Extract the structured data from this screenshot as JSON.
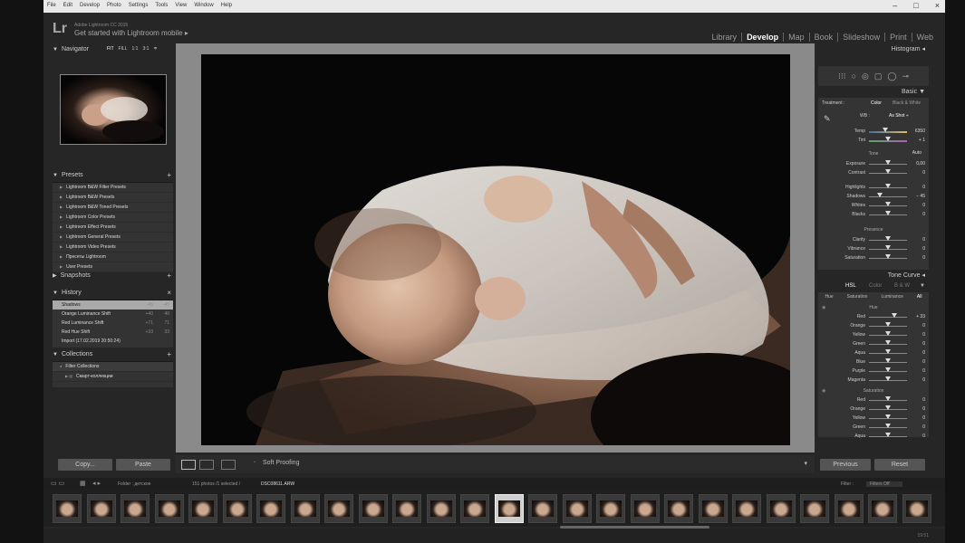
{
  "app": {
    "menu": [
      "File",
      "Edit",
      "Develop",
      "Photo",
      "Settings",
      "Tools",
      "View",
      "Window",
      "Help"
    ],
    "window_controls": [
      "–",
      "□",
      "×"
    ],
    "logo": "Lr",
    "subtitle": "Adobe Lightroom CC 2015",
    "mobile_prompt": "Get started with Lightroom mobile",
    "mobile_arrow": "▸",
    "modules": [
      {
        "label": "Library",
        "active": false
      },
      {
        "label": "Develop",
        "active": true
      },
      {
        "label": "Map",
        "active": false
      },
      {
        "label": "Book",
        "active": false
      },
      {
        "label": "Slideshow",
        "active": false
      },
      {
        "label": "Print",
        "active": false
      },
      {
        "label": "Web",
        "active": false
      }
    ]
  },
  "left": {
    "navigator": {
      "title": "Navigator",
      "zoom": [
        "FIT",
        "FILL",
        "1:1",
        "3:1"
      ],
      "zoom_extra": "≑"
    },
    "presets": {
      "title": "Presets",
      "items": [
        "Lightroom B&W Filter Presets",
        "Lightroom B&W Presets",
        "Lightroom B&W Toned Presets",
        "Lightroom Color Presets",
        "Lightroom Effect Presets",
        "Lightroom General Presets",
        "Lightroom Video Presets",
        "Пресеты Lightroom",
        "User Presets"
      ]
    },
    "snapshots": {
      "title": "Snapshots"
    },
    "history": {
      "title": "History",
      "items": [
        {
          "label": "Shadows",
          "a": "-45",
          "b": "-45",
          "selected": true
        },
        {
          "label": "Orange Luminance Shift",
          "a": "+40",
          "b": "40",
          "selected": false
        },
        {
          "label": "Red Luminance Shift",
          "a": "+71",
          "b": "71",
          "selected": false
        },
        {
          "label": "Red Hue Shift",
          "a": "+33",
          "b": "33",
          "selected": false
        },
        {
          "label": "Import (17.02.2019 20:50:24)",
          "a": "",
          "b": "",
          "selected": false
        }
      ]
    },
    "collections": {
      "title": "Collections",
      "items": [
        "Filter Collections",
        "Смарт-коллекции"
      ]
    },
    "copy_label": "Copy...",
    "paste_label": "Paste"
  },
  "toolbar": {
    "soft_proofing": "Soft Proofing"
  },
  "right": {
    "histogram": "Histogram",
    "tool_icons": [
      "⁝⁝⁝",
      "○",
      "◎",
      "▢",
      "◯",
      "⊸"
    ],
    "basic": {
      "title": "Basic",
      "treatment_label": "Treatment :",
      "color_label": "Color",
      "bw_label": "Black & White",
      "wb_label": "WB :",
      "wb_value": "As Shot ÷",
      "temp": {
        "label": "Temp",
        "value": "6350",
        "pos": 0.42
      },
      "tint": {
        "label": "Tint",
        "value": "+ 1",
        "pos": 0.5
      },
      "tone_label": "Tone",
      "auto_label": "Auto",
      "sliders": [
        {
          "label": "Exposure",
          "value": "0,00",
          "pos": 0.5
        },
        {
          "label": "Contrast",
          "value": "0",
          "pos": 0.5
        },
        {
          "label": "Highlights",
          "value": "0",
          "pos": 0.5
        },
        {
          "label": "Shadows",
          "value": "− 45",
          "pos": 0.28
        },
        {
          "label": "Whites",
          "value": "0",
          "pos": 0.5
        },
        {
          "label": "Blacks",
          "value": "0",
          "pos": 0.5
        }
      ],
      "presence_label": "Presence",
      "presence": [
        {
          "label": "Clarity",
          "value": "0",
          "pos": 0.5
        },
        {
          "label": "Vibrance",
          "value": "0",
          "pos": 0.5
        },
        {
          "label": "Saturation",
          "value": "0",
          "pos": 0.5
        }
      ]
    },
    "tone_curve": "Tone Curve",
    "hsl": {
      "tabs": [
        "HSL",
        "Color",
        "B & W"
      ],
      "subtabs": [
        "Hue",
        "Saturation",
        "Luminance",
        "All"
      ],
      "hue_label": "Hue",
      "hue": [
        {
          "label": "Red",
          "value": "+ 33",
          "pos": 0.66
        },
        {
          "label": "Orange",
          "value": "0",
          "pos": 0.5
        },
        {
          "label": "Yellow",
          "value": "0",
          "pos": 0.5
        },
        {
          "label": "Green",
          "value": "0",
          "pos": 0.5
        },
        {
          "label": "Aqua",
          "value": "0",
          "pos": 0.5
        },
        {
          "label": "Blue",
          "value": "0",
          "pos": 0.5
        },
        {
          "label": "Purple",
          "value": "0",
          "pos": 0.5
        },
        {
          "label": "Magenta",
          "value": "0",
          "pos": 0.5
        }
      ],
      "saturation_label": "Saturation",
      "saturation": [
        {
          "label": "Red",
          "value": "0",
          "pos": 0.5
        },
        {
          "label": "Orange",
          "value": "0",
          "pos": 0.5
        },
        {
          "label": "Yellow",
          "value": "0",
          "pos": 0.5
        },
        {
          "label": "Green",
          "value": "0",
          "pos": 0.5
        },
        {
          "label": "Aqua",
          "value": "0",
          "pos": 0.5
        }
      ]
    },
    "previous_label": "Previous",
    "reset_label": "Reset"
  },
  "filmstrip": {
    "folder": "Folder : детское",
    "count": "151 photos /1 selected /",
    "filename": "DSC08611.ARW",
    "filter_label": "Filter :",
    "filter_value": "Filters Off",
    "thumb_count": 26,
    "selected_index": 13
  },
  "status": {
    "time": "19:51"
  }
}
